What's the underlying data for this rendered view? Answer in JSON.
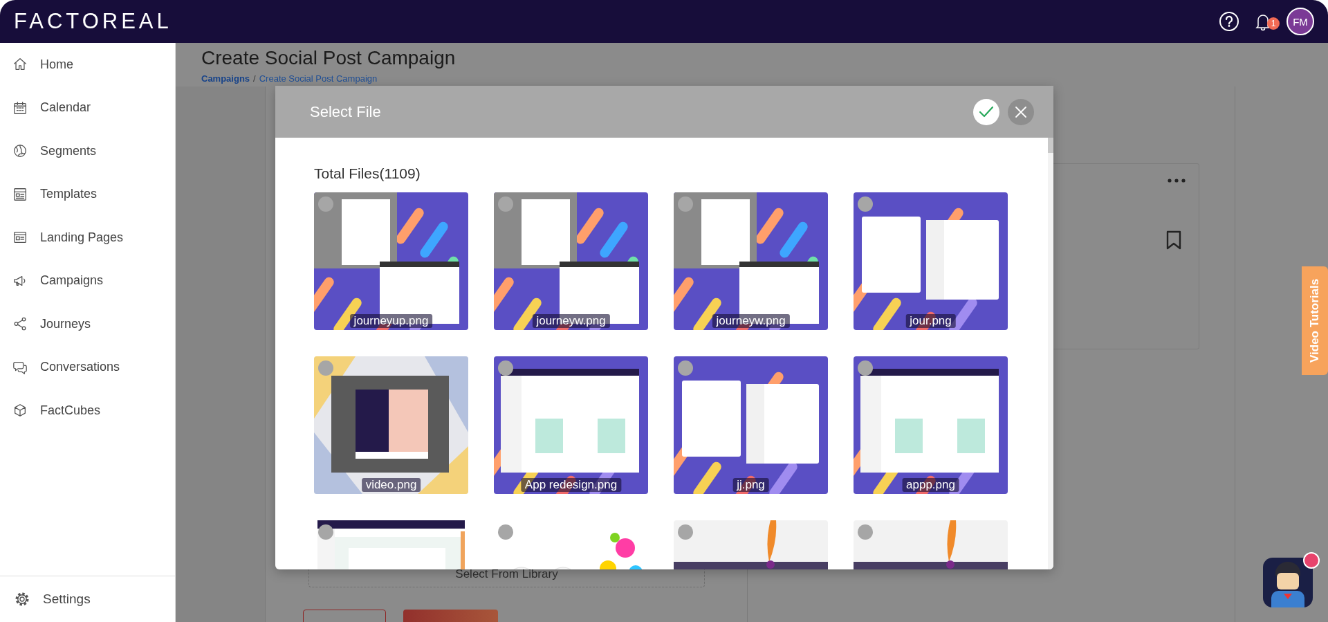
{
  "header": {
    "logo": "FACTOREAL",
    "notification_count": "1",
    "avatar_initials": "FM"
  },
  "sidebar": {
    "items": [
      {
        "label": "Home",
        "selected": false
      },
      {
        "label": "Calendar",
        "selected": false
      },
      {
        "label": "Segments",
        "selected": false
      },
      {
        "label": "Templates",
        "selected": false
      },
      {
        "label": "Landing Pages",
        "selected": false
      },
      {
        "label": "Campaigns",
        "selected": false
      },
      {
        "label": "Journeys",
        "selected": false
      },
      {
        "label": "Conversations",
        "selected": false
      },
      {
        "label": "FactCubes",
        "selected": false
      }
    ],
    "footer_item": {
      "label": "Settings"
    }
  },
  "page": {
    "title": "Create Social Post Campaign",
    "breadcrumb": [
      {
        "label": "Campaigns"
      },
      {
        "label": "Create Social Post Campaign"
      }
    ],
    "breadcrumb_separator": "/",
    "library_button": "Select From Library"
  },
  "modal": {
    "title": "Select File",
    "total_files": "Total Files(1109)",
    "files": [
      {
        "name": "journeyup.png",
        "selected": false
      },
      {
        "name": "journeyw.png",
        "selected": false
      },
      {
        "name": "journeyw.png",
        "selected": false
      },
      {
        "name": "jour.png",
        "selected": false
      },
      {
        "name": "video.png",
        "selected": false
      },
      {
        "name": "App redesign.png",
        "selected": false
      },
      {
        "name": "jj.png",
        "selected": false
      },
      {
        "name": "appp.png",
        "selected": false
      },
      {
        "selected": false
      },
      {
        "selected": false
      },
      {
        "selected": false
      },
      {
        "selected": false
      }
    ]
  },
  "video_tutorials": "Video Tutorials"
}
